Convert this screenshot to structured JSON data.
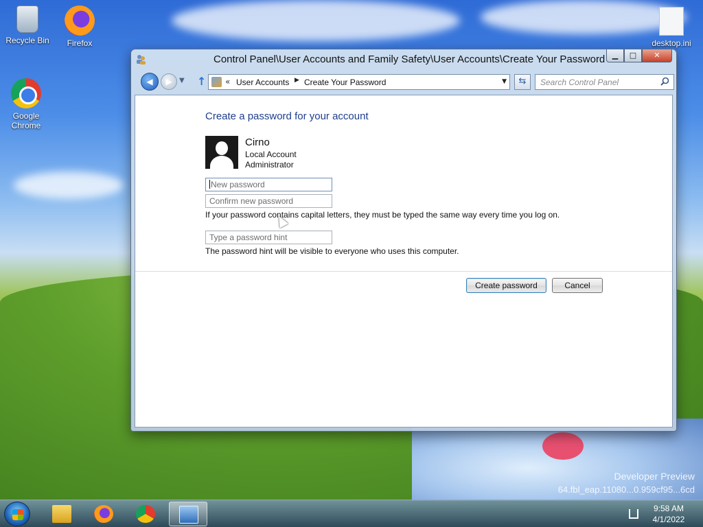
{
  "desktop": {
    "icons": [
      {
        "label": "Recycle Bin"
      },
      {
        "label": "Firefox"
      },
      {
        "label": "Google Chrome"
      },
      {
        "label": "desktop.ini"
      }
    ],
    "watermark_line1": "Developer Preview",
    "watermark_line2": "64.fbl_eap.11080...0.959cf95...6cd"
  },
  "window": {
    "title": "Control Panel\\User Accounts and Family Safety\\User Accounts\\Create Your Password",
    "caption_buttons": {
      "minimize": "▁",
      "maximize": "□",
      "close": "✕"
    }
  },
  "navigation": {
    "back_glyph": "◀",
    "forward_glyph": "▶",
    "breadcrumb_prefix": "«",
    "breadcrumbs": [
      "User Accounts",
      "Create Your Password"
    ],
    "search_placeholder": "Search Control Panel"
  },
  "content": {
    "heading": "Create a password for your account",
    "account": {
      "name": "Cirno",
      "type": "Local Account",
      "role": "Administrator"
    },
    "new_password_placeholder": "New password",
    "confirm_password_placeholder": "Confirm new password",
    "capital_letters_note": "If your password contains capital letters, they must be typed the same way every time you log on.",
    "hint_placeholder": "Type a password hint",
    "hint_note": "The password hint will be visible to everyone who uses this computer.",
    "create_button": "Create password",
    "cancel_button": "Cancel"
  },
  "taskbar": {
    "apps": [
      "Windows Explorer",
      "Firefox",
      "Google Chrome",
      "Control Panel"
    ],
    "active_app": "Control Panel",
    "time": "9:58 AM",
    "date": "4/1/2022"
  },
  "colors": {
    "heading": "#1e3e8c",
    "close_button": "#c7432a",
    "primary_button_border": "#3c7fb1"
  }
}
